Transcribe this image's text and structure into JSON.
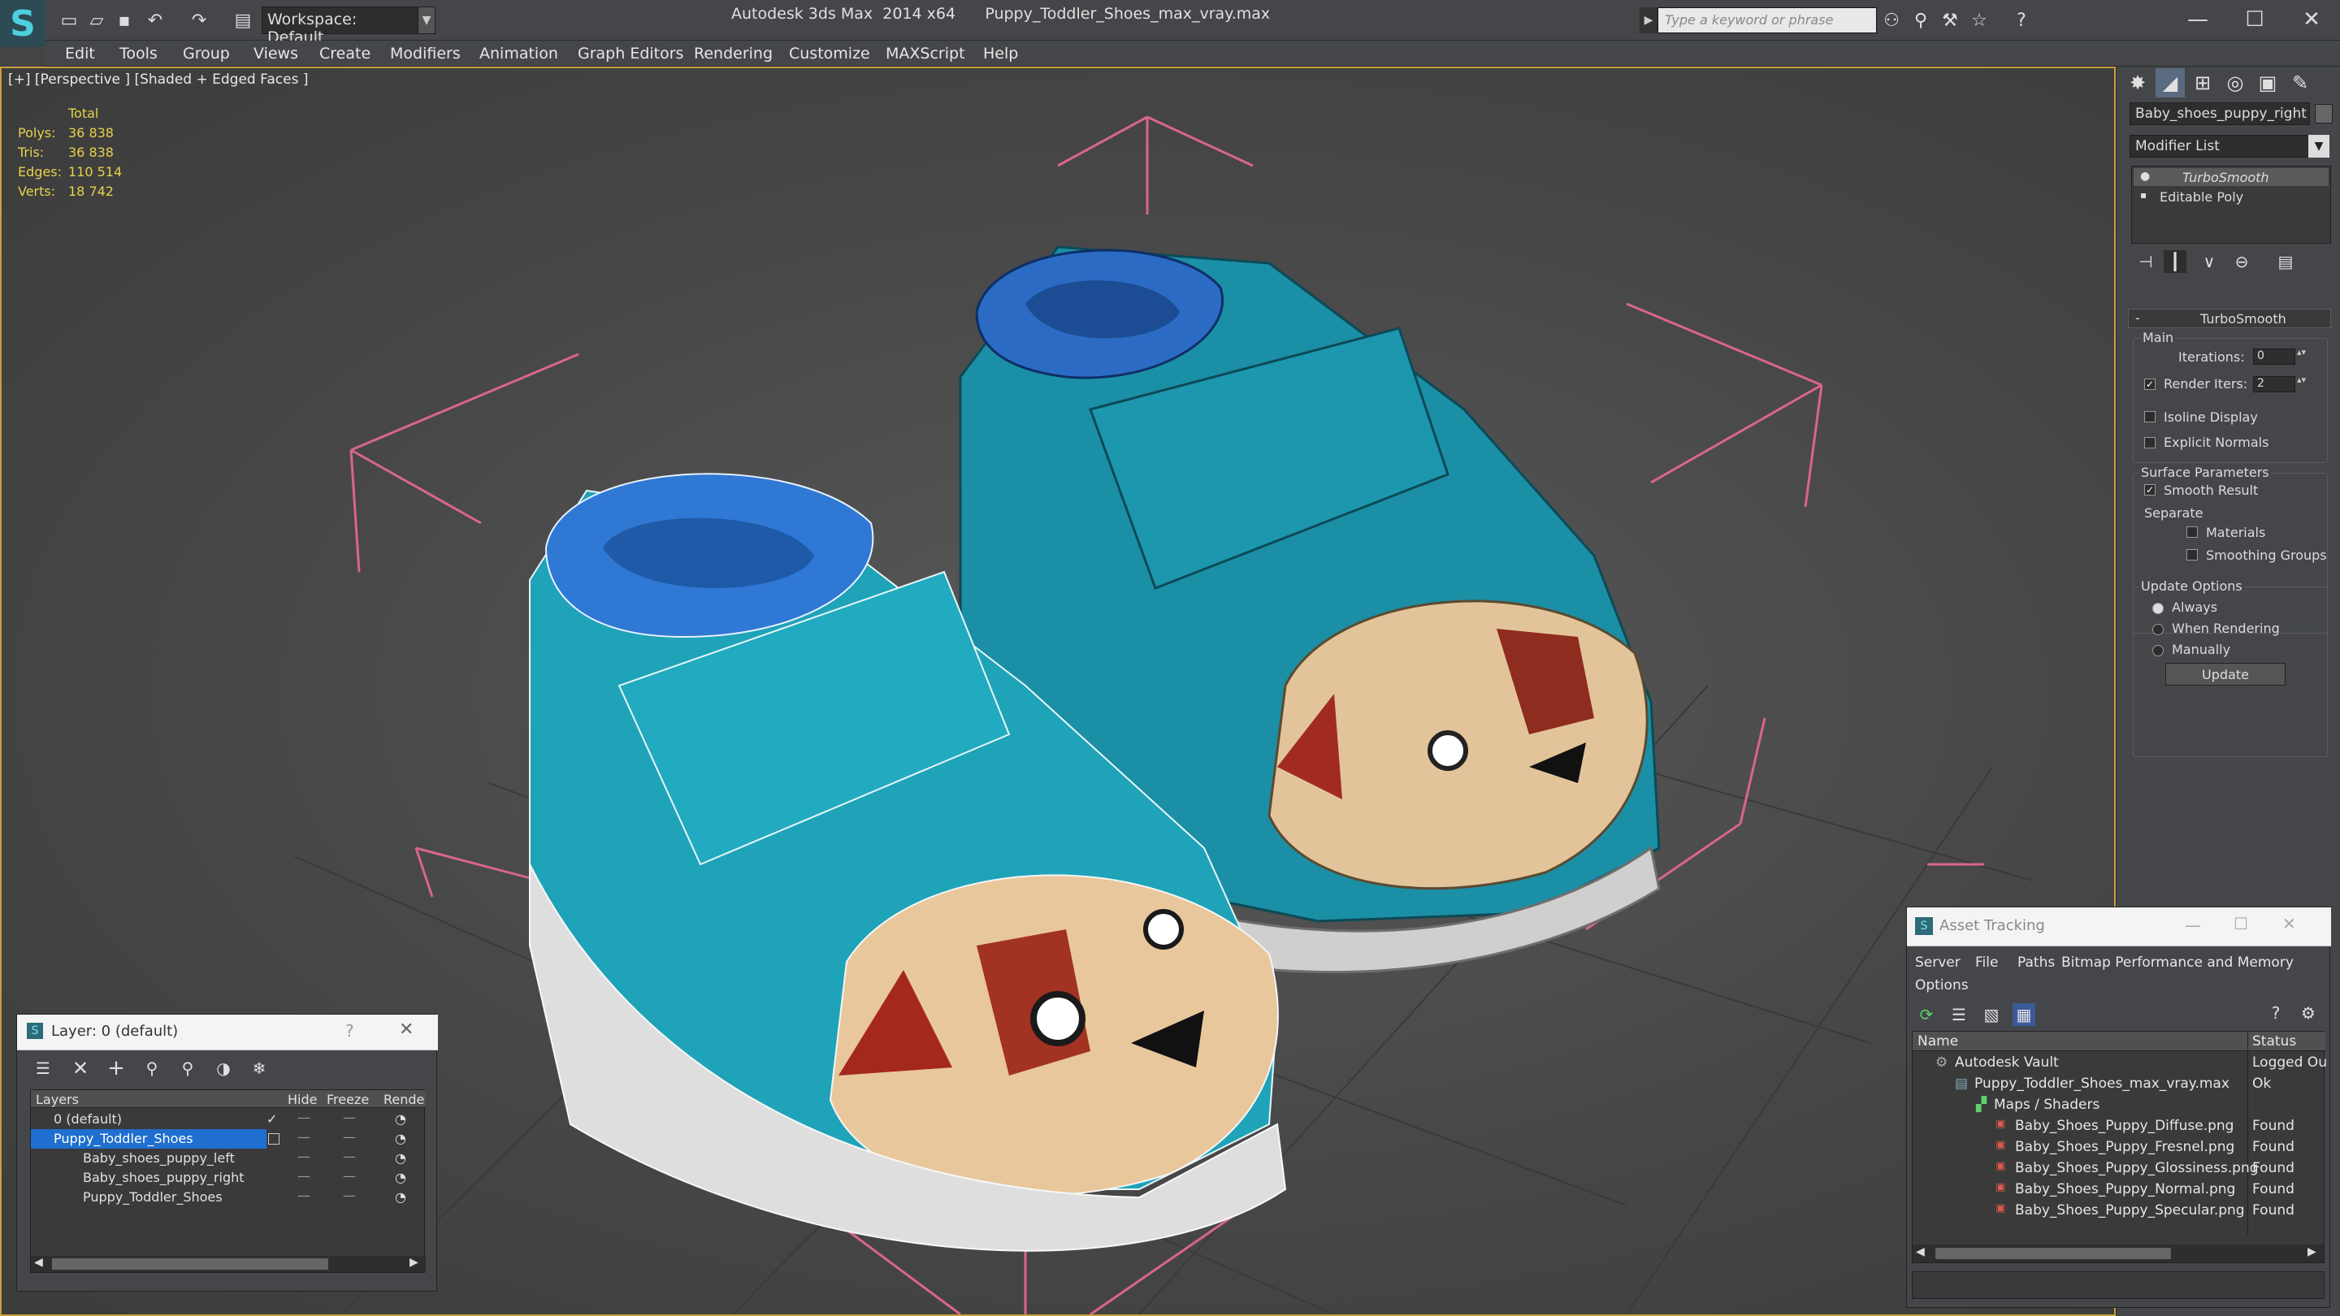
{
  "title_bar": {
    "workspace": "Workspace: Default",
    "app_name": "Autodesk 3ds Max  2014 x64",
    "file_name": "Puppy_Toddler_Shoes_max_vray.max",
    "search_placeholder": "Type a keyword or phrase"
  },
  "menu": [
    "Edit",
    "Tools",
    "Group",
    "Views",
    "Create",
    "Modifiers",
    "Animation",
    "Graph Editors",
    "Rendering",
    "Customize",
    "MAXScript",
    "Help"
  ],
  "viewport": {
    "label": "[+] [Perspective ] [Shaded + Edged Faces ]",
    "stats": {
      "header": "Total",
      "rows": [
        {
          "label": "Polys:",
          "value": "36 838"
        },
        {
          "label": "Tris:",
          "value": "36 838"
        },
        {
          "label": "Edges:",
          "value": "110 514"
        },
        {
          "label": "Verts:",
          "value": "18 742"
        }
      ]
    }
  },
  "command_panel": {
    "object_name": "Baby_shoes_puppy_right",
    "modifier_list": "Modifier List",
    "stack": [
      "TurboSmooth",
      "Editable Poly"
    ],
    "rollout_title": "TurboSmooth",
    "main_label": "Main",
    "iterations_label": "Iterations:",
    "iterations_value": "0",
    "render_iters_label": "Render Iters:",
    "render_iters_value": "2",
    "isoline": "Isoline Display",
    "explicit": "Explicit Normals",
    "surface_params": "Surface Parameters",
    "smooth_result": "Smooth Result",
    "separate": "Separate",
    "materials": "Materials",
    "smoothing_groups": "Smoothing Groups",
    "update_options": "Update Options",
    "always": "Always",
    "when_rendering": "When Rendering",
    "manually": "Manually",
    "update_button": "Update"
  },
  "layer_dialog": {
    "title": "Layer: 0 (default)",
    "help": "?",
    "columns": [
      "Layers",
      "Hide",
      "Freeze",
      "Rende"
    ],
    "rows": [
      {
        "name": "0 (default)",
        "selected": false
      },
      {
        "name": "Puppy_Toddler_Shoes",
        "selected": true
      },
      {
        "name": "Baby_shoes_puppy_left",
        "selected": false
      },
      {
        "name": "Baby_shoes_puppy_right",
        "selected": false
      },
      {
        "name": "Puppy_Toddler_Shoes",
        "selected": false
      }
    ]
  },
  "asset_tracking": {
    "title": "Asset Tracking",
    "menu": [
      "Server",
      "File",
      "Paths",
      "Bitmap Performance and Memory",
      "Options"
    ],
    "columns": [
      "Name",
      "Status"
    ],
    "rows": [
      {
        "name": "Autodesk Vault",
        "status": "Logged Ou"
      },
      {
        "name": "Puppy_Toddler_Shoes_max_vray.max",
        "status": "Ok"
      },
      {
        "name": "Maps / Shaders",
        "status": ""
      },
      {
        "name": "Baby_Shoes_Puppy_Diffuse.png",
        "status": "Found"
      },
      {
        "name": "Baby_Shoes_Puppy_Fresnel.png",
        "status": "Found"
      },
      {
        "name": "Baby_Shoes_Puppy_Glossiness.png",
        "status": "Found"
      },
      {
        "name": "Baby_Shoes_Puppy_Normal.png",
        "status": "Found"
      },
      {
        "name": "Baby_Shoes_Puppy_Specular.png",
        "status": "Found"
      }
    ]
  },
  "colors": {
    "accent_yellow": "#e6d24a",
    "selection_blue": "#1e6fd0",
    "shoe_teal": "#1aa3b8",
    "toe_tan": "#e6c59a"
  }
}
